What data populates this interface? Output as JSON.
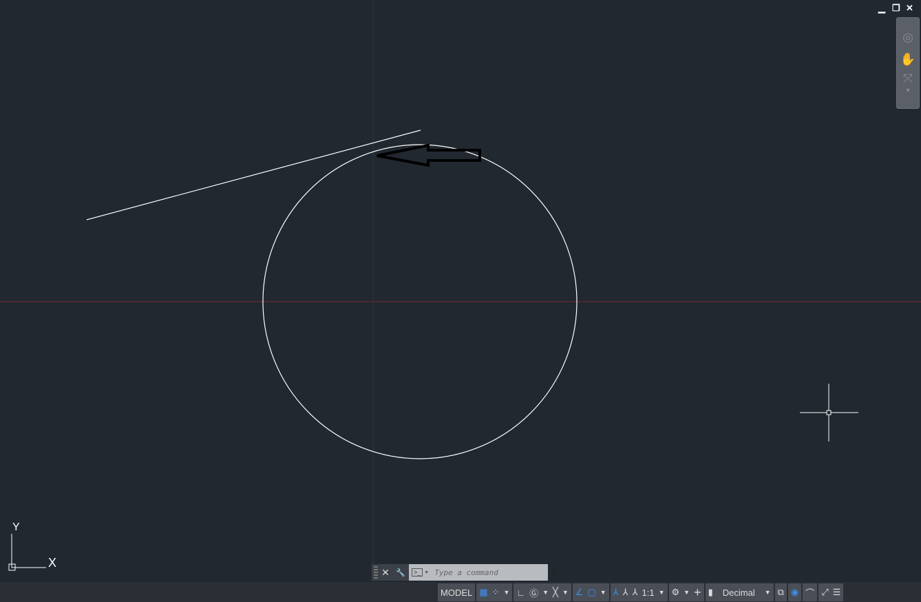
{
  "window_controls": {
    "minimize": "▁",
    "restore": "❐",
    "close": "✕"
  },
  "ucs": {
    "x_label": "X",
    "y_label": "Y"
  },
  "command_line": {
    "placeholder": "Type a command",
    "close_icon": "✕",
    "settings_icon": "🔧",
    "prompt_icon": ">_",
    "expand_icon": "▲"
  },
  "status_bar": {
    "model_label": "MODEL",
    "scale_label": "1:1",
    "units_label": "Decimal",
    "icons": [
      "grid-icon",
      "snap-icon",
      "ortho-icon",
      "polar-icon",
      "isodraft-icon",
      "object-snap-tracking-icon",
      "object-snap-icon",
      "annotation-visibility-icon",
      "autoscale-icon",
      "annotation-scale-icon",
      "workspace-gear-icon",
      "annotation-monitor-icon",
      "units-icon",
      "quick-properties-icon",
      "isolate-icon",
      "hardware-acceleration-icon",
      "clean-screen-icon",
      "customize-icon"
    ]
  },
  "colors": {
    "background": "#212830",
    "x_axis": "#8a2a2a",
    "geometry": "#ffffff",
    "arrow": "#000000"
  }
}
